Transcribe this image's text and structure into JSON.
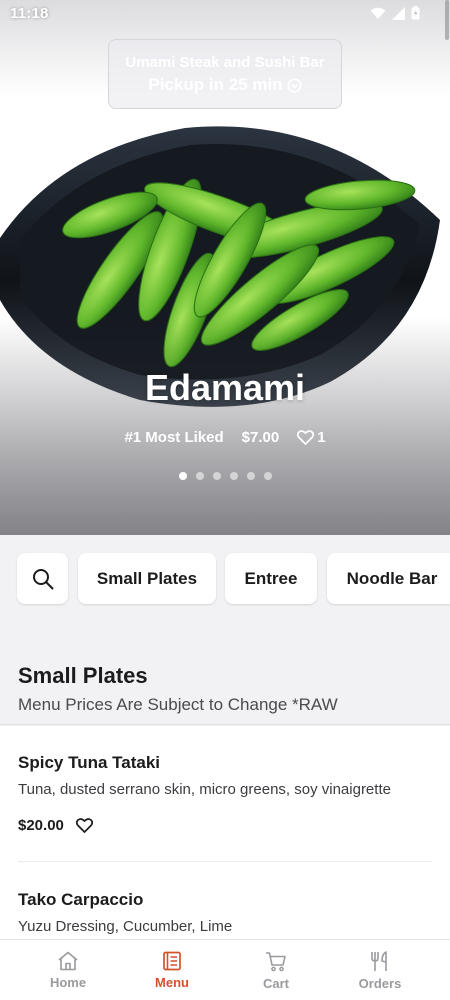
{
  "status_bar": {
    "time": "11:18"
  },
  "restaurant": {
    "name": "Umami Steak and Sushi Bar",
    "pickup": "Pickup in 25 min"
  },
  "featured": {
    "title": "Edamami",
    "badge": "#1 Most Liked",
    "price": "$7.00",
    "likes": "1",
    "carousel_count": 6,
    "carousel_active": 1
  },
  "categories": {
    "search_icon": "search-icon",
    "items": [
      "Small Plates",
      "Entree",
      "Noodle Bar"
    ]
  },
  "section": {
    "title": "Small Plates",
    "subtitle": "Menu Prices Are Subject to Change *RAW"
  },
  "menu_items": [
    {
      "name": "Spicy Tuna Tataki",
      "description": "Tuna, dusted serrano skin, micro greens, soy vinaigrette",
      "price": "$20.00"
    },
    {
      "name": "Tako Carpaccio",
      "description": "Yuzu Dressing, Cucumber, Lime"
    }
  ],
  "bottom_nav": {
    "items": [
      {
        "label": "Home",
        "icon": "home-icon"
      },
      {
        "label": "Menu",
        "icon": "menu-book-icon"
      },
      {
        "label": "Cart",
        "icon": "cart-icon"
      },
      {
        "label": "Orders",
        "icon": "fork-knife-icon"
      }
    ],
    "active_index": 1,
    "active_color": "#d4522a",
    "inactive_color": "#9a9a9f"
  }
}
